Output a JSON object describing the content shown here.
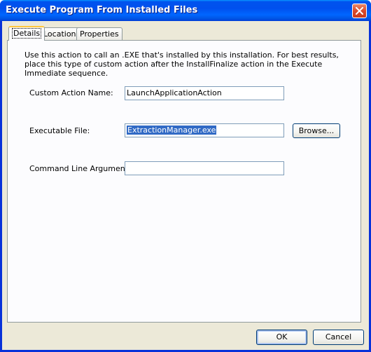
{
  "window": {
    "title": "Execute Program From Installed Files"
  },
  "tabs": [
    {
      "label": "Details",
      "active": true
    },
    {
      "label": "Location",
      "active": false
    },
    {
      "label": "Properties",
      "active": false
    }
  ],
  "details": {
    "description": "Use this action to call an .EXE that's installed by this installation. For best results, place this type of custom action after the InstallFinalize action in the Execute Immediate sequence.",
    "custom_action_name_label": "Custom Action Name:",
    "custom_action_name_value": "LaunchApplicationAction",
    "executable_file_label": "Executable File:",
    "executable_file_value": "ExtractionManager.exe",
    "browse_label": "Browse...",
    "command_line_label": "Command Line Arguments:",
    "command_line_value": ""
  },
  "footer": {
    "ok_label": "OK",
    "cancel_label": "Cancel"
  },
  "colors": {
    "titlebar": "#0053ee",
    "dialog_bg": "#ece9d8",
    "selection": "#316ac5",
    "close_button": "#d9492a"
  }
}
